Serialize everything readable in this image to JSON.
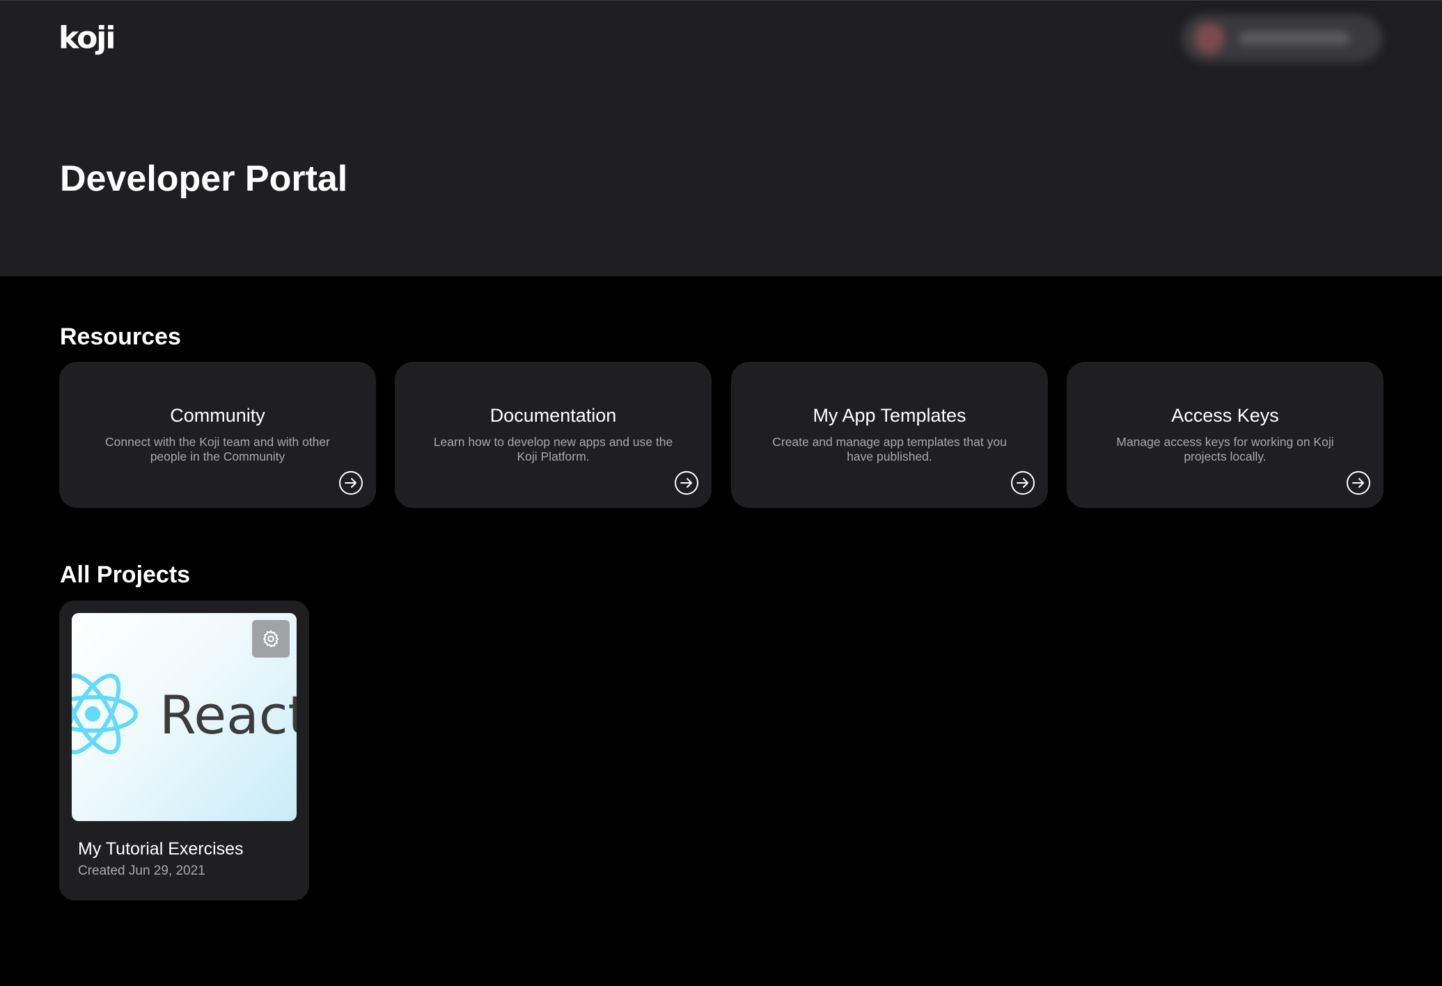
{
  "header": {
    "logo": "koji",
    "page_title": "Developer Portal"
  },
  "resources": {
    "title": "Resources",
    "cards": [
      {
        "title": "Community",
        "description": "Connect with the Koji team and with other people in the Community"
      },
      {
        "title": "Documentation",
        "description": "Learn how to develop new apps and use the Koji Platform."
      },
      {
        "title": "My App Templates",
        "description": "Create and manage app templates that you have published."
      },
      {
        "title": "Access Keys",
        "description": "Manage access keys for working on Koji projects locally."
      }
    ],
    "card_icon": "arrow-right-circle-icon"
  },
  "projects": {
    "title": "All Projects",
    "items": [
      {
        "name": "My Tutorial Exercises",
        "created": "Created Jun 29, 2021",
        "thumbnail_text": "React",
        "settings_icon": "gear-icon"
      }
    ]
  },
  "colors": {
    "page_bg": "#000000",
    "header_bg": "#1f1f21",
    "card_bg": "#1f1f21",
    "muted_text": "#a8a8ac",
    "react_blue": "#61dafb"
  }
}
